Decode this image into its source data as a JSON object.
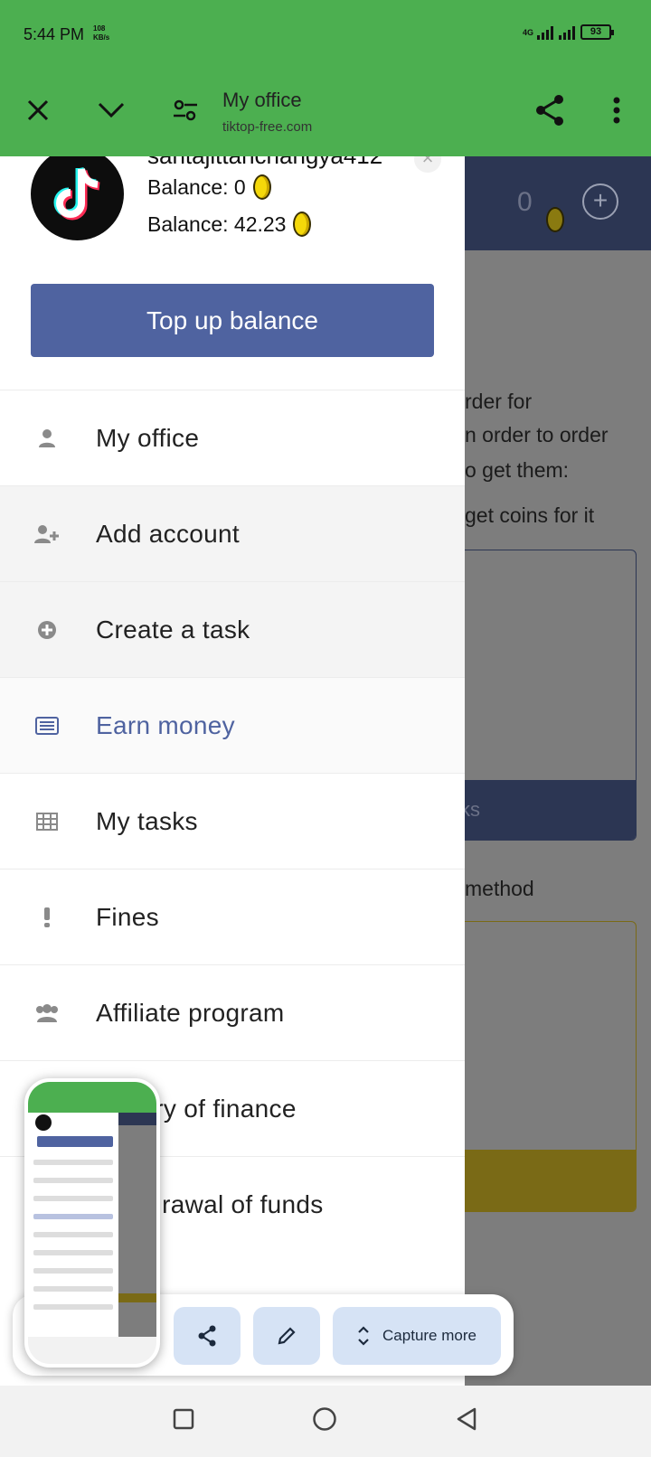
{
  "status_bar": {
    "time": "5:44 PM",
    "speed_value": "108",
    "speed_unit": "KB/s",
    "network": "4G",
    "battery": "93"
  },
  "toolbar": {
    "title": "My office",
    "url": "tiktop-free.com",
    "close_icon": "close-icon",
    "collapse_icon": "chevron-down-icon",
    "settings_icon": "tune-icon",
    "share_icon": "share-icon",
    "more_icon": "more-vert-icon"
  },
  "background_page": {
    "balance": "0",
    "lines": [
      "rder for",
      "n order to order",
      "o get them:",
      "get coins for it"
    ],
    "box_button": "ks",
    "method_text": "method"
  },
  "drawer": {
    "username": "santajittanchangya412",
    "balance_1": "Balance: 0",
    "balance_2": "Balance: 42.23",
    "topup_label": "Top up balance",
    "menu": [
      {
        "label": "My office",
        "icon": "user-icon"
      },
      {
        "label": "Add account",
        "icon": "user-plus-icon"
      },
      {
        "label": "Create a task",
        "icon": "plus-circle-icon"
      },
      {
        "label": "Earn money",
        "icon": "list-card-icon"
      },
      {
        "label": "My tasks",
        "icon": "table-icon"
      },
      {
        "label": "Fines",
        "icon": "exclamation-icon"
      },
      {
        "label": "Affiliate program",
        "icon": "users-icon"
      },
      {
        "label": "History of finance",
        "icon": "history-icon"
      },
      {
        "label": "Withdrawal of funds",
        "icon": "wallet-icon"
      }
    ]
  },
  "capture_toolbar": {
    "capture_more_label": "Capture more"
  },
  "colors": {
    "toolbar_green": "#4caf50",
    "accent_blue": "#4f63a0",
    "dark_header": "#2c3653"
  }
}
